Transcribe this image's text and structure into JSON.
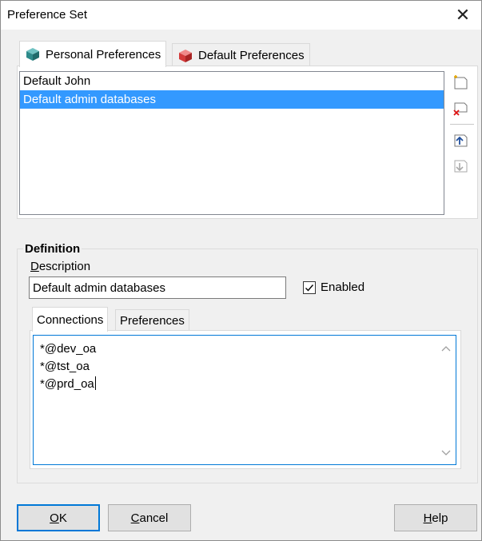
{
  "window": {
    "title": "Preference Set",
    "close_glyph": "✕"
  },
  "tabs": [
    {
      "label": "Personal Preferences",
      "icon": "green-cube-icon",
      "active": true,
      "icon_color": "#2e8b8b"
    },
    {
      "label": "Default Preferences",
      "icon": "red-cube-icon",
      "active": false,
      "icon_color": "#d33a3a"
    }
  ],
  "preference_list": {
    "items": [
      {
        "label": "Default John",
        "selected": false
      },
      {
        "label": "Default admin databases",
        "selected": true
      }
    ],
    "selection_color": "#3399ff"
  },
  "toolbar": {
    "items": [
      {
        "name": "new-item-icon"
      },
      {
        "name": "delete-item-icon"
      },
      {
        "name": "move-up-icon"
      },
      {
        "name": "move-down-icon"
      }
    ]
  },
  "definition": {
    "group_label": "Definition",
    "description_label_accel": "D",
    "description_label_rest": "escription",
    "description_value": "Default admin databases",
    "enabled_label": "Enabled",
    "enabled_checked": true
  },
  "subtabs": [
    {
      "label": "Connections",
      "active": true
    },
    {
      "label": "Preferences",
      "active": false
    }
  ],
  "connections": [
    "*@dev_oa",
    "*@tst_oa",
    "*@prd_oa"
  ],
  "buttons": {
    "ok": {
      "accel": "O",
      "rest": "K"
    },
    "cancel": {
      "accel": "C",
      "rest": "ancel"
    },
    "help": {
      "accel": "H",
      "rest": "elp"
    }
  },
  "colors": {
    "focus_border": "#0078d7",
    "background": "#f0f0f0"
  }
}
